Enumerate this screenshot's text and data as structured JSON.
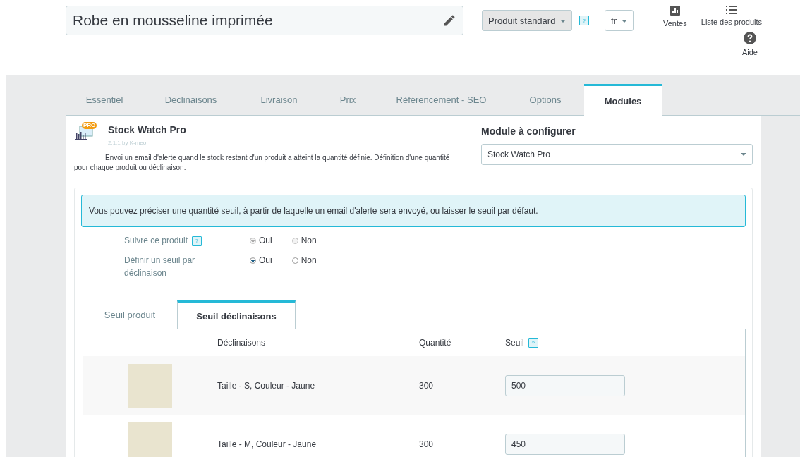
{
  "header": {
    "product_name": "Robe en mousseline imprimée",
    "product_type": "Produit standard",
    "help": "?",
    "language": "fr",
    "actions": [
      {
        "label": "Ventes",
        "kind": "chart"
      },
      {
        "label": "Liste des produits",
        "kind": "list"
      },
      {
        "label": "Aide",
        "kind": "help"
      }
    ]
  },
  "tabs": [
    {
      "label": "Essentiel",
      "selected": false
    },
    {
      "label": "Déclinaisons",
      "selected": false
    },
    {
      "label": "Livraison",
      "selected": false
    },
    {
      "label": "Prix",
      "selected": false
    },
    {
      "label": "Référencement - SEO",
      "selected": false
    },
    {
      "label": "Options",
      "selected": false
    },
    {
      "label": "Modules",
      "selected": true
    }
  ],
  "module": {
    "name": "Stock Watch Pro",
    "version": "2.1.1 by K-meo",
    "description": "Envoi un email d'alerte quand le stock restant d'un produit a atteint la quantité définie. Définition d'une quantité pour chaque produit ou déclinaison.",
    "badge": "PRO"
  },
  "module_select": {
    "label": "Module à configurer",
    "value": "Stock Watch Pro"
  },
  "alert": "Vous pouvez préciser une quantité seuil, à partir de laquelle un email d'alerte sera envoyé, ou laisser le seuil par défaut.",
  "settings": [
    {
      "label": "Suivre ce produit",
      "help": "?",
      "disabled": true,
      "options": [
        {
          "label": "Oui",
          "selected": true
        },
        {
          "label": "Non",
          "selected": false
        }
      ]
    },
    {
      "label": "Définir un seuil par déclinaison",
      "disabled": false,
      "options": [
        {
          "label": "Oui",
          "selected": true
        },
        {
          "label": "Non",
          "selected": false
        }
      ]
    }
  ],
  "sub_tabs": [
    {
      "label": "Seuil produit",
      "selected": false
    },
    {
      "label": "Seuil déclinaisons",
      "selected": true
    }
  ],
  "table": {
    "columns": [
      "Déclinaisons",
      "Quantité",
      "Seuil"
    ],
    "seuil_help": "?",
    "rows": [
      {
        "combination": "Taille - S, Couleur - Jaune",
        "quantity": "300",
        "threshold": "500"
      },
      {
        "combination": "Taille - M, Couleur - Jaune",
        "quantity": "300",
        "threshold": "450"
      }
    ]
  }
}
